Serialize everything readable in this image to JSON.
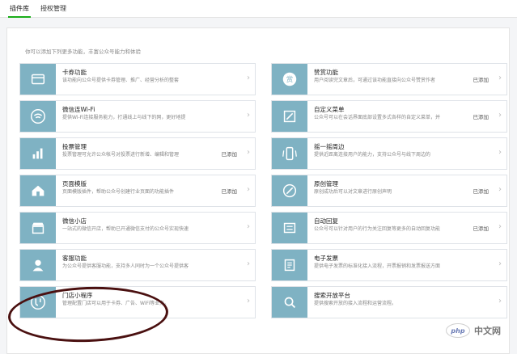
{
  "tabs": {
    "plugins": "插件库",
    "auth": "授权管理"
  },
  "intro": "你可以添加下列更多功能，丰富公众号能力和体验",
  "colors": {
    "teal": "#7fb2c3",
    "accent": "#1aad19",
    "circle": "#4a1010"
  },
  "cards": [
    {
      "title": "卡券功能",
      "desc": "该功能向公众号提供卡券管理、推广、经营分析的整套",
      "status": "",
      "icon": "card-icon"
    },
    {
      "title": "赞赏功能",
      "desc": "用户阅读完文章后，可通过该功能直接向公众号赞赏作者",
      "status": "已添加",
      "icon": "reward-icon"
    },
    {
      "title": "微信连Wi-Fi",
      "desc": "提供Wi-Fi连接服务能力，打通线上与线下的网，更好地提",
      "status": "",
      "icon": "wifi-icon"
    },
    {
      "title": "自定义菜单",
      "desc": "公众号可以在会话界面底部设置多式各样的自定义菜单，并",
      "status": "已添加",
      "icon": "menu-edit-icon"
    },
    {
      "title": "投票管理",
      "desc": "投票管理可允许公众帐号对投票进行新增、编辑和管理",
      "status": "已添加",
      "icon": "chart-icon"
    },
    {
      "title": "摇一摇周边",
      "desc": "提供近距离连接用户的能力，支持公众号与线下周边的",
      "status": "",
      "icon": "shake-icon"
    },
    {
      "title": "页面模版",
      "desc": "页面模版插件，帮助公众号创建行业页面的功能插件",
      "status": "已添加",
      "icon": "home-icon"
    },
    {
      "title": "原创管理",
      "desc": "原创成功后可以对文章进行原创声明",
      "status": "已添加",
      "icon": "compass-icon"
    },
    {
      "title": "微信小店",
      "desc": "一站式的微信开店，帮助已开通微信支付的公众号实现快速",
      "status": "",
      "icon": "shop-icon"
    },
    {
      "title": "自动回复",
      "desc": "公众号可以针对用户的行为关注回复等更多的自动回复功能",
      "status": "已添加",
      "icon": "reply-icon"
    },
    {
      "title": "客服功能",
      "desc": "为公众号提供客服功能，支持多人同时为一个公众号提供客",
      "status": "",
      "icon": "service-icon"
    },
    {
      "title": "电子发票",
      "desc": "提供电子发票的标准化接入流程，开票报销和发票报送方面",
      "status": "",
      "icon": "invoice-icon"
    },
    {
      "title": "门店小程序",
      "desc": "管理配置门店可以用于卡券、广告、WiFi等业务。",
      "status": "",
      "icon": "store-icon"
    },
    {
      "title": "搜索开放平台",
      "desc": "提供搜索开放的接入流程和运营流程。",
      "status": "",
      "icon": "search-icon"
    }
  ],
  "arrow": "›",
  "watermark": {
    "badge": "php",
    "text": "中文网"
  }
}
